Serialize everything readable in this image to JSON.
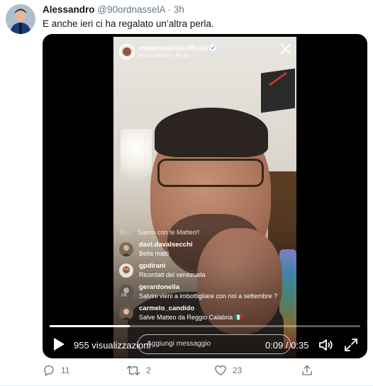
{
  "tweet": {
    "author_name": "Alessandro",
    "handle": "@90ordnasselA",
    "separator": "·",
    "time": "3h",
    "text": "E anche ieri ci ha regalato un’altra perla."
  },
  "instagram_live": {
    "username": "matteosalviniofficial",
    "status": "era in diretta · 6h fa",
    "joined_text": "Siamo con te Matteo!!",
    "comments": [
      {
        "user": "davi.davalsecchi",
        "text": "Bella matti"
      },
      {
        "user": "gpdirani",
        "text": "Ricordati del venezuela"
      },
      {
        "user": "gerardonella",
        "text": "Salvini vieni a imbottigliare con noi a settembre ?"
      },
      {
        "user": "carmelo_candido",
        "text": "Salve Matteo da Reggio Calabria 🇮🇹"
      }
    ],
    "input_placeholder": "Aggiungi messaggio"
  },
  "video": {
    "views": "955 visualizzazioni",
    "current_time": "0:09",
    "total_time": "0:35",
    "time_separator": " / ",
    "progress_fraction": 0.257
  },
  "actions": {
    "replies": "11",
    "retweets": "2",
    "likes": "23"
  },
  "colors": {
    "accent": "#1da1f2",
    "muted": "#657786",
    "text": "#14171a"
  }
}
